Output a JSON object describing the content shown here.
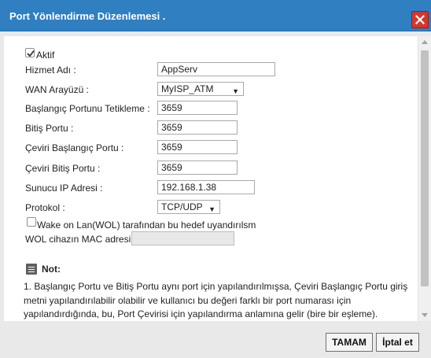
{
  "dialog": {
    "title": "Port Yönlendirme Düzenlemesi ."
  },
  "form": {
    "active_label": "Aktif",
    "active_checked": true,
    "service_name_label": "Hizmet Adı :",
    "service_name_value": "AppServ",
    "wan_interface_label": "WAN Arayüzü :",
    "wan_interface_value": "MyISP_ATM",
    "trigger_start_port_label": "Başlangıç Portunu Tetikleme :",
    "trigger_start_port_value": "3659",
    "end_port_label": "Bitiş Portu :",
    "end_port_value": "3659",
    "translation_start_port_label": "Çeviri Başlangıç Portu :",
    "translation_start_port_value": "3659",
    "translation_end_port_label": "Çeviri Bitiş Portu :",
    "translation_end_port_value": "3659",
    "server_ip_label": "Sunucu IP Adresi :",
    "server_ip_value": "192.168.1.38",
    "protocol_label": "Protokol :",
    "protocol_value": "TCP/UDP",
    "wol_label": "Wake on Lan(WOL) tarafından bu hedef uyandırılsm",
    "wol_checked": false,
    "wol_mac_label": "WOL cihazın MAC adresi",
    "wol_mac_value": ""
  },
  "note": {
    "title": "Not:",
    "text": "1.   Başlangıç Portu ve Bitiş Portu aynı port için yapılandırılmışsa, Çeviri Başlangıç Portu giriş metni yapılandırılabilir olabilir ve kullanıcı bu değeri farklı bir port numarası için yapılandırdığında, bu, Port Çevirisi için yapılandırma anlamına gelir (bire bir eşleme)."
  },
  "buttons": {
    "ok_label": "TAMAM",
    "cancel_label": "İptal et"
  },
  "colors": {
    "titlebar": "#2f7fc1",
    "close": "#d9352a",
    "footer": "#e9e9e9"
  },
  "icons": {
    "close": "close-icon",
    "note": "note-icon",
    "dropdown": "chevron-down-icon",
    "check": "checkmark-icon"
  }
}
